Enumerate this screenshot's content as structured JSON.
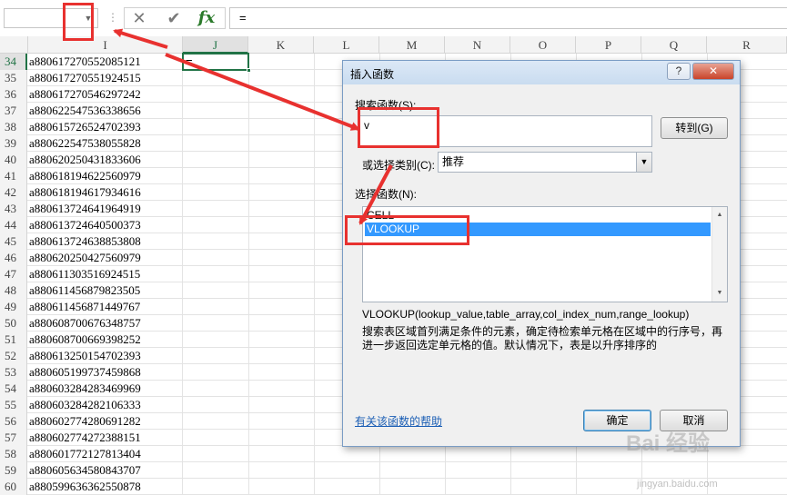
{
  "formula_bar": {
    "cancel_icon": "x-icon",
    "enter_icon": "check-icon",
    "fx_label": "fx",
    "formula_value": "="
  },
  "sheet": {
    "columns": [
      "I",
      "J",
      "K",
      "L",
      "M",
      "N",
      "O",
      "P",
      "Q",
      "R"
    ],
    "active_column": "J",
    "active_row": "34",
    "active_cell_value": "=",
    "rows": [
      {
        "num": "34",
        "i": "a880617270552085121"
      },
      {
        "num": "35",
        "i": "a880617270551924515"
      },
      {
        "num": "36",
        "i": "a880617270546297242"
      },
      {
        "num": "37",
        "i": "a880622547536338656"
      },
      {
        "num": "38",
        "i": "a880615726524702393"
      },
      {
        "num": "39",
        "i": "a880622547538055828"
      },
      {
        "num": "40",
        "i": "a880620250431833606"
      },
      {
        "num": "41",
        "i": "a880618194622560979"
      },
      {
        "num": "42",
        "i": "a880618194617934616"
      },
      {
        "num": "43",
        "i": "a880613724641964919"
      },
      {
        "num": "44",
        "i": "a880613724640500373"
      },
      {
        "num": "45",
        "i": "a880613724638853808"
      },
      {
        "num": "46",
        "i": "a880620250427560979"
      },
      {
        "num": "47",
        "i": "a880611303516924515"
      },
      {
        "num": "48",
        "i": "a880611456879823505"
      },
      {
        "num": "49",
        "i": "a880611456871449767"
      },
      {
        "num": "50",
        "i": "a880608700676348757"
      },
      {
        "num": "51",
        "i": "a880608700669398252"
      },
      {
        "num": "52",
        "i": "a880613250154702393"
      },
      {
        "num": "53",
        "i": "a880605199737459868"
      },
      {
        "num": "54",
        "i": "a880603284283469969"
      },
      {
        "num": "55",
        "i": "a880603284282106333"
      },
      {
        "num": "56",
        "i": "a880602774280691282"
      },
      {
        "num": "57",
        "i": "a880602774272388151"
      },
      {
        "num": "58",
        "i": "a880601772127813404"
      },
      {
        "num": "59",
        "i": "a880605634580843707"
      },
      {
        "num": "60",
        "i": "a880599636362550878"
      }
    ]
  },
  "dialog": {
    "title": "插入函数",
    "help_button": "?",
    "close_button": "✕",
    "search_label": "搜索函数(S):",
    "search_value": "v",
    "goto_button": "转到(G)",
    "category_label": "或选择类别(C):",
    "category_value": "推荐",
    "list_label": "选择函数(N):",
    "functions": [
      "CELL",
      "VLOOKUP"
    ],
    "selected_function": "VLOOKUP",
    "signature": "VLOOKUP(lookup_value,table_array,col_index_num,range_lookup)",
    "description": "搜索表区域首列满足条件的元素，确定待检索单元格在区域中的行序号，再进一步返回选定单元格的值。默认情况下，表是以升序排序的",
    "help_link": "有关该函数的帮助",
    "ok_button": "确定",
    "cancel_button": "取消"
  },
  "watermark": {
    "text": "Bai 经验",
    "sub": "jingyan.baidu.com"
  },
  "colors": {
    "accent_green": "#217346",
    "annotation_red": "#e8312f",
    "selection_blue": "#3399ff"
  }
}
